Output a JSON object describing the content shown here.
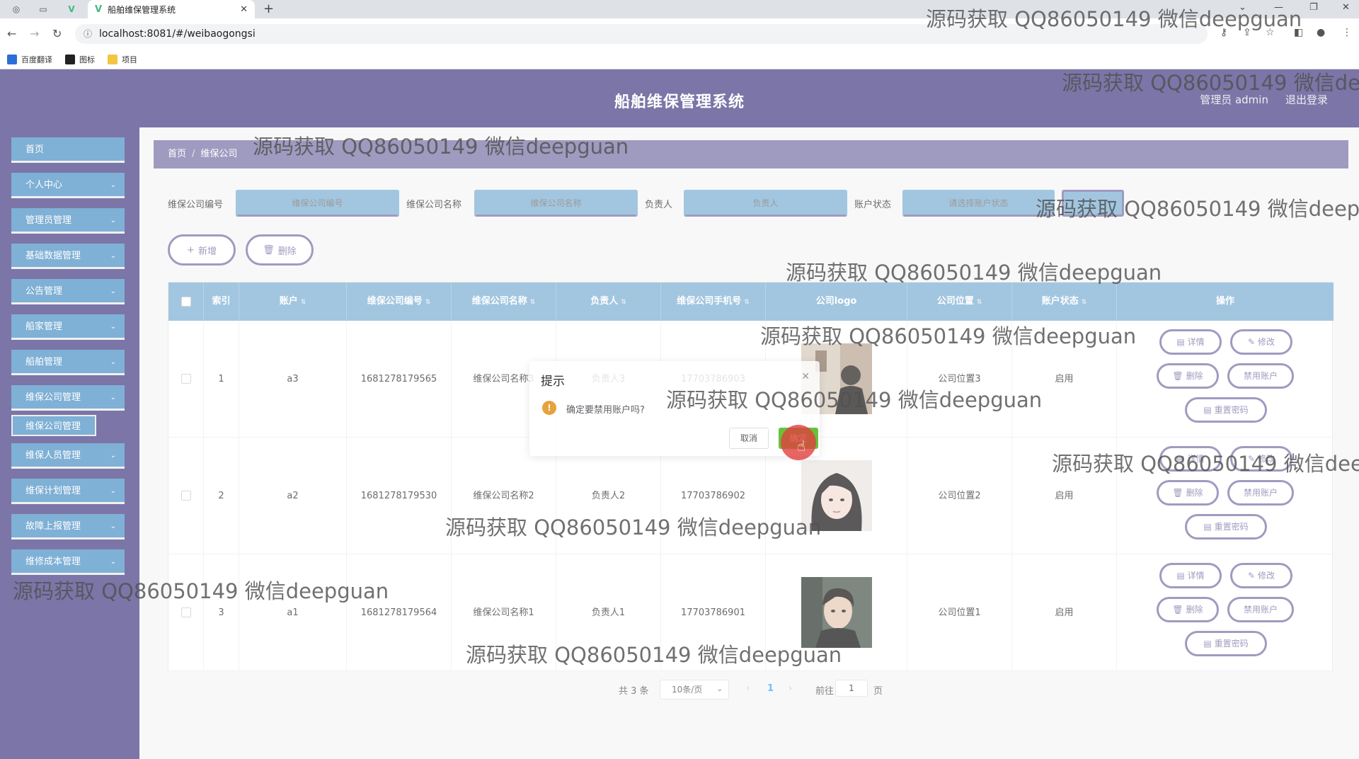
{
  "browser": {
    "tab_title": "船舶维保管理系统",
    "url": "localhost:8081/#/weibaogongsi",
    "bookmarks": [
      "百度翻译",
      "图标",
      "项目"
    ]
  },
  "header": {
    "title": "船舶维保管理系统",
    "user_label": "管理员 admin",
    "logout": "退出登录"
  },
  "sidebar": {
    "items": [
      {
        "label": "首页",
        "chevron": false
      },
      {
        "label": "个人中心",
        "chevron": true
      },
      {
        "label": "管理员管理",
        "chevron": true
      },
      {
        "label": "基础数据管理",
        "chevron": true
      },
      {
        "label": "公告管理",
        "chevron": true
      },
      {
        "label": "船家管理",
        "chevron": true
      },
      {
        "label": "船舶管理",
        "chevron": true
      },
      {
        "label": "维保公司管理",
        "chevron": true
      },
      {
        "label": "维保人员管理",
        "chevron": true
      },
      {
        "label": "维保计划管理",
        "chevron": true
      },
      {
        "label": "故障上报管理",
        "chevron": true
      },
      {
        "label": "维修成本管理",
        "chevron": true
      }
    ],
    "active_sub": "维保公司管理"
  },
  "breadcrumb": {
    "home": "首页",
    "current": "维保公司"
  },
  "search": {
    "fields": [
      {
        "label": "维保公司编号",
        "placeholder": "维保公司编号"
      },
      {
        "label": "维保公司名称",
        "placeholder": "维保公司名称"
      },
      {
        "label": "负责人",
        "placeholder": "负责人"
      },
      {
        "label": "账户状态",
        "placeholder": "请选择账户状态"
      }
    ]
  },
  "actions": {
    "add": "新增",
    "delete": "删除"
  },
  "table": {
    "columns": [
      "索引",
      "账户",
      "维保公司编号",
      "维保公司名称",
      "负责人",
      "维保公司手机号",
      "公司logo",
      "公司位置",
      "账户状态",
      "操作"
    ],
    "rows": [
      {
        "index": "1",
        "account": "a3",
        "code": "1681278179565",
        "name": "维保公司名称3",
        "manager": "负责人3",
        "phone": "17703786903",
        "location": "公司位置3",
        "status": "启用"
      },
      {
        "index": "2",
        "account": "a2",
        "code": "1681278179530",
        "name": "维保公司名称2",
        "manager": "负责人2",
        "phone": "17703786902",
        "location": "公司位置2",
        "status": "启用"
      },
      {
        "index": "3",
        "account": "a1",
        "code": "1681278179564",
        "name": "维保公司名称1",
        "manager": "负责人1",
        "phone": "17703786901",
        "location": "公司位置1",
        "status": "启用"
      }
    ],
    "row_actions": {
      "detail": "详情",
      "edit": "修改",
      "delete": "删除",
      "disable": "禁用账户",
      "reset": "重置密码"
    }
  },
  "pagination": {
    "total": "共 3 条",
    "page_size": "10条/页",
    "current": "1",
    "goto_prefix": "前往",
    "goto_value": "1",
    "goto_suffix": "页"
  },
  "dialog": {
    "title": "提示",
    "message": "确定要禁用账户吗?",
    "cancel": "取消",
    "confirm": "确定"
  },
  "watermark": "源码获取 QQ86050149 微信deepguan",
  "colors": {
    "primary": "#7b75a8",
    "accent": "#7fb0d5",
    "warning": "#e6a23c",
    "confirm": "#67c23a"
  }
}
